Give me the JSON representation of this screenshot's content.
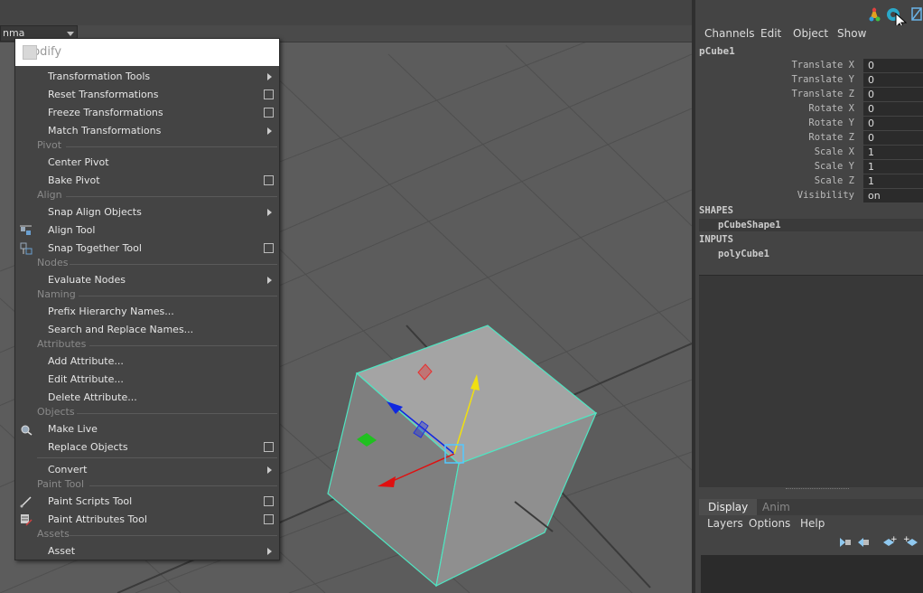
{
  "viewport": {
    "panel_combo": "nma"
  },
  "menu": {
    "title": "Modify",
    "groups": [
      {
        "items": [
          {
            "label": "Transformation Tools"
          },
          {
            "label": "Reset Transformations"
          },
          {
            "label": "Freeze Transformations"
          },
          {
            "label": "Match Transformations"
          }
        ]
      },
      {
        "section": "Pivot",
        "items": [
          {
            "label": "Center Pivot"
          },
          {
            "label": "Bake Pivot"
          }
        ]
      },
      {
        "section": "Align",
        "items": [
          {
            "label": "Snap Align Objects"
          },
          {
            "label": "Align Tool",
            "icon": "align-tool-icon"
          },
          {
            "label": "Snap Together Tool",
            "icon": "snap-together-icon"
          }
        ]
      },
      {
        "section": "Nodes",
        "items": [
          {
            "label": "Evaluate Nodes"
          }
        ]
      },
      {
        "section": "Naming",
        "items": [
          {
            "label": "Prefix Hierarchy Names..."
          },
          {
            "label": "Search and Replace Names..."
          }
        ]
      },
      {
        "section": "Attributes",
        "items": [
          {
            "label": "Add Attribute..."
          },
          {
            "label": "Edit Attribute..."
          },
          {
            "label": "Delete Attribute..."
          }
        ]
      },
      {
        "section": "Objects",
        "items": [
          {
            "label": "Make Live",
            "icon": "make-live-icon"
          },
          {
            "label": "Replace Objects"
          },
          {
            "label": "Convert"
          }
        ]
      },
      {
        "section": "Paint Tool",
        "items": [
          {
            "label": "Paint Scripts Tool",
            "icon": "paint-brush-icon"
          },
          {
            "label": "Paint Attributes Tool",
            "icon": "paint-attributes-icon"
          }
        ]
      },
      {
        "section": "Assets",
        "items": [
          {
            "label": "Asset"
          }
        ]
      }
    ]
  },
  "channel_box": {
    "menu": [
      "Channels",
      "Edit",
      "Object",
      "Show"
    ],
    "object_name": "pCube1",
    "attributes": [
      {
        "label": "Translate X",
        "value": "0"
      },
      {
        "label": "Translate Y",
        "value": "0"
      },
      {
        "label": "Translate Z",
        "value": "0"
      },
      {
        "label": "Rotate X",
        "value": "0"
      },
      {
        "label": "Rotate Y",
        "value": "0"
      },
      {
        "label": "Rotate Z",
        "value": "0"
      },
      {
        "label": "Scale X",
        "value": "1"
      },
      {
        "label": "Scale Y",
        "value": "1"
      },
      {
        "label": "Scale Z",
        "value": "1"
      },
      {
        "label": "Visibility",
        "value": "on"
      }
    ],
    "shapes_header": "SHAPES",
    "shape_name": "pCubeShape1",
    "inputs_header": "INPUTS",
    "input_name": "polyCube1"
  },
  "layer_editor": {
    "tabs": [
      "Display",
      "Anim"
    ],
    "menu": [
      "Layers",
      "Options",
      "Help"
    ]
  },
  "colors": {
    "accent_selection": "#4fe6c2",
    "axis_x": "#e01010",
    "axis_y": "#f0e010",
    "axis_z": "#1028e0"
  }
}
